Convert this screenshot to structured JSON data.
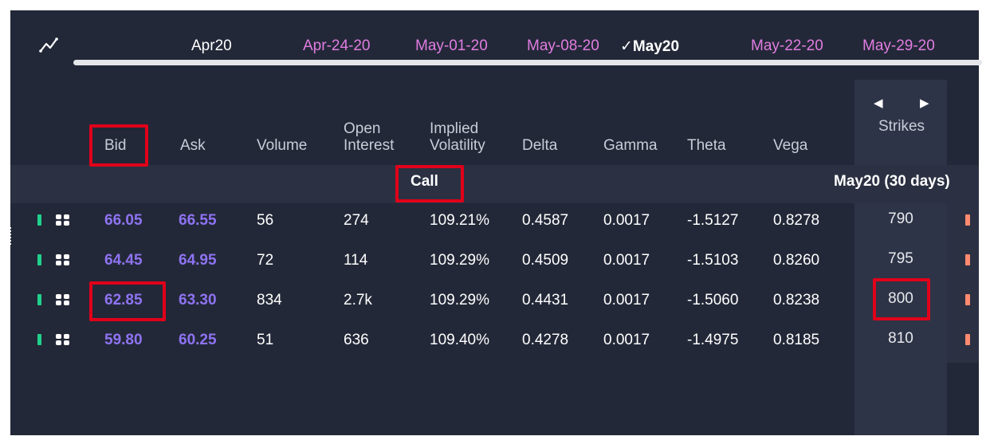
{
  "expirations": {
    "tabs": [
      {
        "label": "Apr20",
        "kind": "month"
      },
      {
        "label": "Apr-24-20",
        "kind": "weekly"
      },
      {
        "label": "May-01-20",
        "kind": "weekly"
      },
      {
        "label": "May-08-20",
        "kind": "weekly"
      },
      {
        "label": "May20",
        "kind": "month-selected",
        "check": "✓"
      },
      {
        "label": "May-22-20",
        "kind": "weekly"
      },
      {
        "label": "May-29-20",
        "kind": "weekly"
      }
    ]
  },
  "columns": {
    "bid": "Bid",
    "ask": "Ask",
    "volume": "Volume",
    "open_interest": [
      "Open",
      "Interest"
    ],
    "implied_volatility": [
      "Implied",
      "Volatility"
    ],
    "delta": "Delta",
    "gamma": "Gamma",
    "theta": "Theta",
    "vega": "Vega",
    "strikes": "Strikes"
  },
  "band": {
    "call_label": "Call",
    "expiry_label": "May20 (30 days)"
  },
  "rows": [
    {
      "bid": "66.05",
      "ask": "66.55",
      "volume": "56",
      "open_interest": "274",
      "iv": "109.21%",
      "delta": "0.4587",
      "gamma": "0.0017",
      "theta": "-1.5127",
      "vega": "0.8278",
      "strike": "790"
    },
    {
      "bid": "64.45",
      "ask": "64.95",
      "volume": "72",
      "open_interest": "114",
      "iv": "109.29%",
      "delta": "0.4509",
      "gamma": "0.0017",
      "theta": "-1.5103",
      "vega": "0.8260",
      "strike": "795"
    },
    {
      "bid": "62.85",
      "ask": "63.30",
      "volume": "834",
      "open_interest": "2.7k",
      "iv": "109.29%",
      "delta": "0.4431",
      "gamma": "0.0017",
      "theta": "-1.5060",
      "vega": "0.8238",
      "strike": "800"
    },
    {
      "bid": "59.80",
      "ask": "60.25",
      "volume": "51",
      "open_interest": "636",
      "iv": "109.40%",
      "delta": "0.4278",
      "gamma": "0.0017",
      "theta": "-1.4975",
      "vega": "0.8185",
      "strike": "810"
    }
  ],
  "icons": {
    "chart": "line-chart-icon",
    "row_actions": "grid-icon",
    "strike_prev": "arrow-left-icon",
    "strike_next": "arrow-right-icon"
  },
  "colors": {
    "background": "#232838",
    "price": "#8e73f2",
    "weekly_expiry": "#e07de0",
    "highlight": "#e0001a",
    "call_marker": "#1fd18c",
    "put_marker": "#ff8a70"
  }
}
